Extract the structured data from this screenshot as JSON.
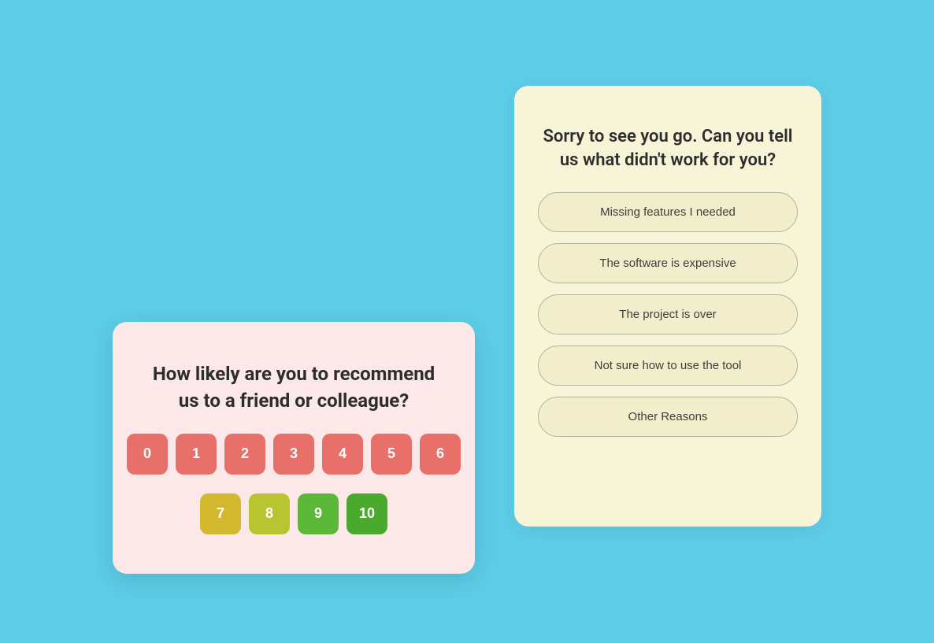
{
  "background_color": "#5ecde8",
  "card_back": {
    "title": "Sorry to see you go. Can you tell us what didn't work for you?",
    "options": [
      {
        "id": "missing-features",
        "label": "Missing features I needed"
      },
      {
        "id": "expensive",
        "label": "The software is expensive"
      },
      {
        "id": "project-over",
        "label": "The project is over"
      },
      {
        "id": "not-sure-how",
        "label": "Not sure how to use the tool"
      },
      {
        "id": "other",
        "label": "Other Reasons"
      }
    ]
  },
  "card_front": {
    "title": "How likely are you to recommend us to a friend or colleague?",
    "nps_row1": [
      {
        "value": "0",
        "color_class": "nps-red"
      },
      {
        "value": "1",
        "color_class": "nps-red"
      },
      {
        "value": "2",
        "color_class": "nps-red"
      },
      {
        "value": "3",
        "color_class": "nps-red"
      },
      {
        "value": "4",
        "color_class": "nps-red"
      },
      {
        "value": "5",
        "color_class": "nps-red"
      },
      {
        "value": "6",
        "color_class": "nps-red"
      }
    ],
    "nps_row2": [
      {
        "value": "7",
        "color_class": "nps-yellow"
      },
      {
        "value": "8",
        "color_class": "nps-yellow-green"
      },
      {
        "value": "9",
        "color_class": "nps-green"
      },
      {
        "value": "10",
        "color_class": "nps-green-dark"
      }
    ]
  }
}
